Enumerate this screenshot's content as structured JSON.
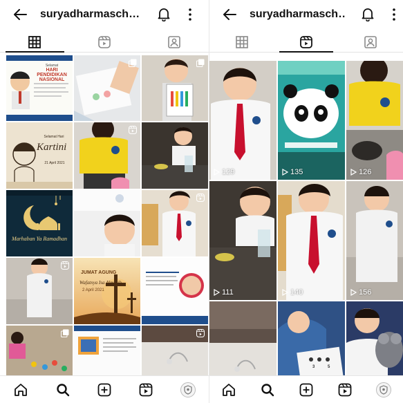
{
  "profile": {
    "username": "suryadharmasch…"
  },
  "left_grid": {
    "posters": {
      "hari_pendidikan": {
        "subtitle": "Selamat",
        "title": "HARI PENDIDIKAN NASIONAL"
      },
      "kartini": {
        "subtitle": "Selamat Hari",
        "title": "Kartini",
        "date": "21 April 2021"
      },
      "ramadhan": {
        "script": "Marhaban Ya Ramadhan"
      },
      "jumat_agung": {
        "title": "JUMAT AGUNG",
        "script": "Wafatnya Isa Almasih",
        "date": "2 April 2021"
      }
    },
    "chart_labels": [
      "3",
      "5"
    ]
  },
  "right_grid": {
    "view_counts": [
      "129",
      "135",
      "126",
      "111",
      "140",
      "156"
    ]
  },
  "colors": {
    "ink": "#111111",
    "divider": "#e6e6e6",
    "red_tie": "#c8102e",
    "uniform_white": "#f7f7f7",
    "yellow_shirt": "#f1d21c"
  }
}
